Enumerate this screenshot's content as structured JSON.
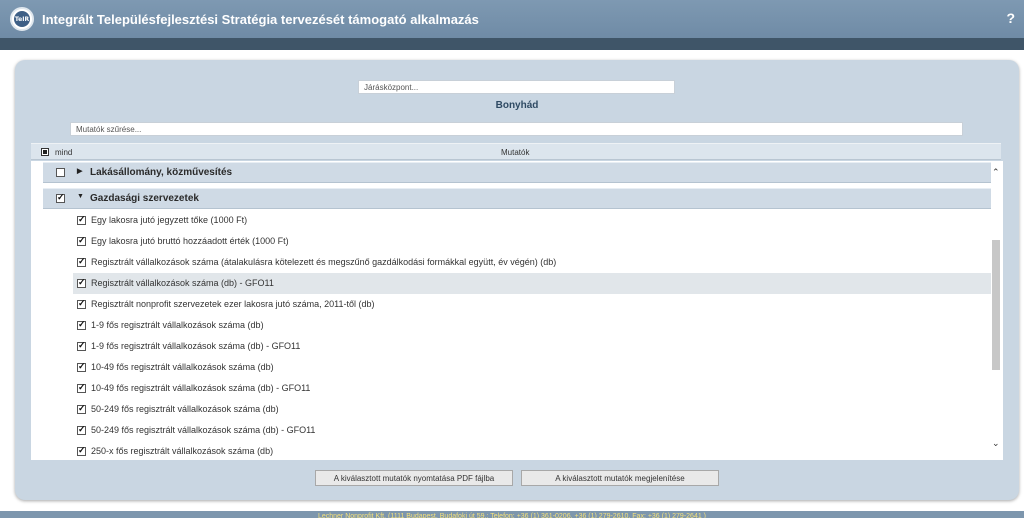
{
  "header": {
    "logo_text": "TeIR",
    "title": "Integrált Településfejlesztési Stratégia tervezését támogató alkalmazás",
    "help": "?"
  },
  "search": {
    "placeholder": "Járásközpont..."
  },
  "location_title": "Bonyhád",
  "filter": {
    "placeholder": "Mutatók szűrése..."
  },
  "list_header": {
    "all_label": "mind",
    "column_label": "Mutatók"
  },
  "groups": [
    {
      "label": "Lakásállomány, közművesítés",
      "checked": false,
      "expanded": false
    },
    {
      "label": "Gazdasági szervezetek",
      "checked": true,
      "expanded": true
    }
  ],
  "items": [
    {
      "label": "Egy lakosra jutó jegyzett tőke (1000 Ft)",
      "checked": true
    },
    {
      "label": "Egy lakosra jutó bruttó hozzáadott érték (1000 Ft)",
      "checked": true
    },
    {
      "label": "Regisztrált vállalkozások száma (átalakulásra kötelezett és megszűnő gazdálkodási formákkal együtt, év végén) (db)",
      "checked": true
    },
    {
      "label": "Regisztrált vállalkozások száma (db) - GFO11",
      "checked": true,
      "highlighted": true
    },
    {
      "label": "Regisztrált nonprofit szervezetek ezer lakosra jutó száma, 2011-től (db)",
      "checked": true
    },
    {
      "label": "1-9 fős regisztrált vállalkozások száma (db)",
      "checked": true
    },
    {
      "label": "1-9 fős regisztrált vállalkozások száma (db) - GFO11",
      "checked": true
    },
    {
      "label": "10-49 fős regisztrált vállalkozások száma (db)",
      "checked": true
    },
    {
      "label": "10-49 fős regisztrált vállalkozások száma (db) - GFO11",
      "checked": true
    },
    {
      "label": "50-249 fős regisztrált vállalkozások száma (db)",
      "checked": true
    },
    {
      "label": "50-249 fős regisztrált vállalkozások száma (db) - GFO11",
      "checked": true
    },
    {
      "label": "250-x fős regisztrált vállalkozások száma (db)",
      "checked": true
    }
  ],
  "buttons": {
    "pdf": "A kiválasztott mutatók nyomtatása PDF fájlba",
    "show": "A kiválasztott mutatók megjelenítése"
  },
  "footer": "Lechner Nonprofit Kft. (1111 Budapest, Budafoki út 59.; Telefon: +36 (1) 361-0206, +36 (1) 279-2610, Fax: +36 (1) 279-2641 )"
}
